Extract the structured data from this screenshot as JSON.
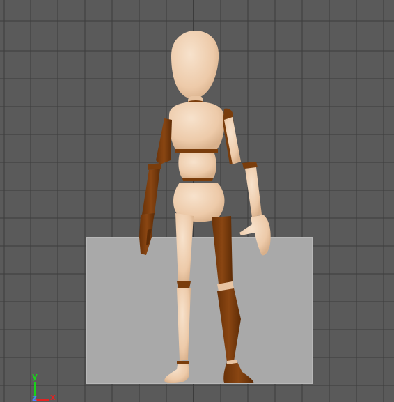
{
  "viewport": {
    "name": "3D viewport",
    "background": "#5a5a5a",
    "grid_color": "#3c3c3c",
    "ground_plane_color": "#a9a9a9"
  },
  "character": {
    "name": "wooden-mannequin",
    "skin_color": "#f0d1b4",
    "joint_color": "#7a3d0c"
  },
  "axis_gizmo": {
    "y_label": "y",
    "x_label": "x",
    "z_label": "z",
    "y_color": "#19d419",
    "x_color": "#e22222",
    "z_color": "#4a7bff"
  }
}
